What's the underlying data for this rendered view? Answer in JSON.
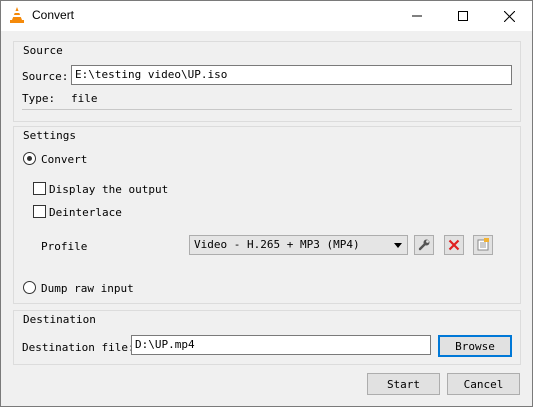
{
  "window": {
    "title": "Convert"
  },
  "source": {
    "group_title": "Source",
    "source_label": "Source:",
    "source_value": "E:\\testing video\\UP.iso",
    "type_label": "Type:",
    "type_value": "file"
  },
  "settings": {
    "group_title": "Settings",
    "convert_label": "Convert",
    "convert_selected": true,
    "display_output_label": "Display the output",
    "display_output_checked": false,
    "deinterlace_label": "Deinterlace",
    "deinterlace_checked": false,
    "profile_label": "Profile",
    "profile_value": "Video - H.265 + MP3 (MP4)",
    "dump_raw_label": "Dump raw input",
    "dump_raw_selected": false
  },
  "destination": {
    "group_title": "Destination",
    "file_label": "Destination file:",
    "file_value": "D:\\UP.mp4",
    "browse_label": "Browse"
  },
  "actions": {
    "start_label": "Start",
    "cancel_label": "Cancel"
  },
  "icons": {
    "app": "vlc-cone-icon",
    "minimize": "minimize-icon",
    "maximize": "maximize-icon",
    "close": "close-icon",
    "edit_profile": "wrench-icon",
    "delete_profile": "delete-x-icon",
    "new_profile": "new-profile-icon"
  },
  "colors": {
    "vlc_orange": "#f58a0b",
    "delete_red": "#e02020",
    "focus_blue": "#0078d7"
  }
}
